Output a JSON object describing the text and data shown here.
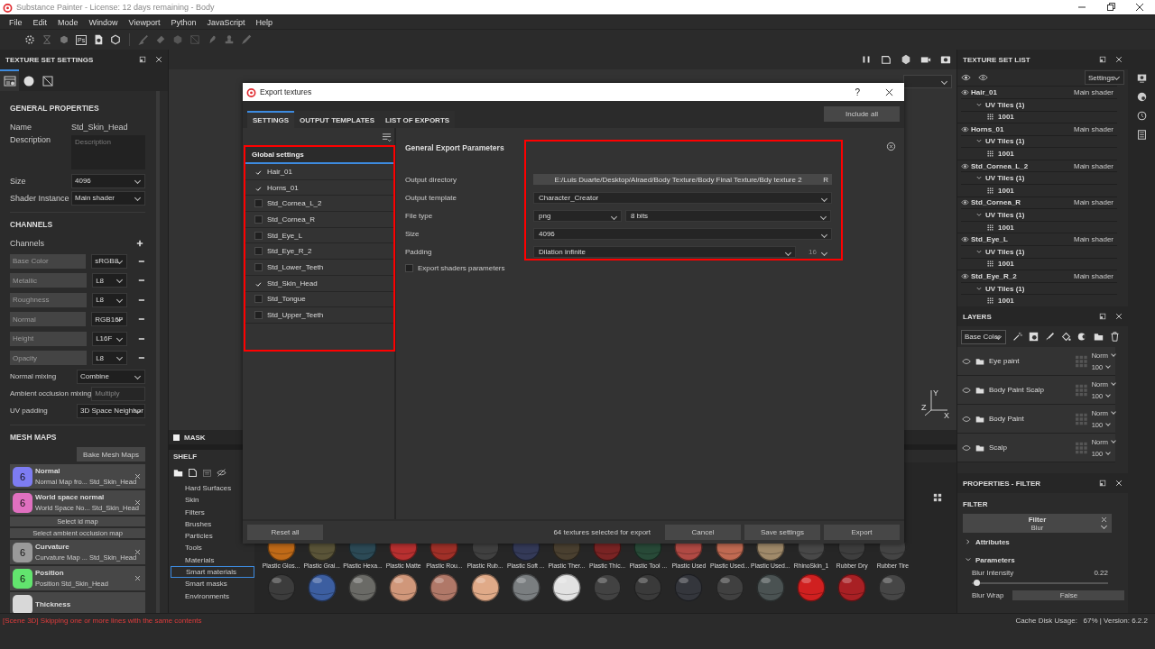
{
  "app_title": "Substance Painter - License: 12 days remaining - Body",
  "menu": [
    "File",
    "Edit",
    "Mode",
    "Window",
    "Viewport",
    "Python",
    "JavaScript",
    "Help"
  ],
  "toolbar": {
    "ps_label": "Ps"
  },
  "texture_set_settings": {
    "title": "TEXTURE SET SETTINGS",
    "tabs": [
      {
        "kind": "settings",
        "selected": true
      },
      {
        "kind": "material",
        "selected": false
      },
      {
        "kind": "uv",
        "selected": false
      }
    ],
    "general_title": "GENERAL PROPERTIES",
    "name_label": "Name",
    "name_value": "Std_Skin_Head",
    "description_label": "Description",
    "description_placeholder": "Description",
    "size_label": "Size",
    "size_value": "4096",
    "shader_label": "Shader Instance",
    "shader_value": "Main shader",
    "channels_title": "CHANNELS",
    "channels_label": "Channels",
    "channels": [
      {
        "name": "Base Color",
        "format": "sRGB8"
      },
      {
        "name": "Metallic",
        "format": "L8"
      },
      {
        "name": "Roughness",
        "format": "L8"
      },
      {
        "name": "Normal",
        "format": "RGB16F"
      },
      {
        "name": "Height",
        "format": "L16F"
      },
      {
        "name": "Opacity",
        "format": "L8"
      }
    ],
    "mixing": [
      {
        "label": "Normal mixing",
        "value": "Combine",
        "disabled": false
      },
      {
        "label": "Ambient occlusion mixing",
        "value": "Multiply",
        "disabled": true
      },
      {
        "label": "UV padding",
        "value": "3D Space Neighbor",
        "disabled": false
      }
    ],
    "mesh_maps_title": "MESH MAPS",
    "bake": "Bake Mesh Maps",
    "mesh_maps": [
      {
        "kind": "map",
        "name": "Normal",
        "source": "Normal Map fro... Std_Skin_Head",
        "badge": "6",
        "color": "#7d7cf2"
      },
      {
        "kind": "map",
        "name": "World space normal",
        "source": "World Space No... Std_Skin_Head",
        "badge": "6",
        "color": "#e070c0"
      },
      {
        "kind": "button",
        "name": "Select id map"
      },
      {
        "kind": "button",
        "name": "Select ambient occlusion map"
      },
      {
        "kind": "map",
        "name": "Curvature",
        "source": "Curvature Map ... Std_Skin_Head",
        "badge": "6",
        "color": "#9a9a9a"
      },
      {
        "kind": "map",
        "name": "Position",
        "source": "Position Std_Skin_Head",
        "badge": "6",
        "color": "#62e46e"
      },
      {
        "kind": "map",
        "name": "Thickness",
        "color": "#d8d8d8"
      }
    ]
  },
  "viewport": {
    "axes": [
      "Y",
      "Z",
      "X"
    ],
    "mask_label": "MASK",
    "mask_checked": true
  },
  "shelf": {
    "title": "SHELF",
    "categories": [
      {
        "label": "Hard Surfaces",
        "selected": false
      },
      {
        "label": "Skin",
        "selected": false
      },
      {
        "label": "Filters",
        "selected": false
      },
      {
        "label": "Brushes",
        "selected": false
      },
      {
        "label": "Particles",
        "selected": false
      },
      {
        "label": "Tools",
        "selected": false
      },
      {
        "label": "Materials",
        "selected": false
      },
      {
        "label": "Smart materials",
        "selected": true
      },
      {
        "label": "Smart masks",
        "selected": false
      },
      {
        "label": "Environments",
        "selected": false
      }
    ],
    "materials": [
      {
        "label": "Plastic Glos...",
        "color": "#c06a18"
      },
      {
        "label": "Plastic Grai...",
        "color": "#5a5438"
      },
      {
        "label": "Plastic Hexa...",
        "color": "#2c4a56"
      },
      {
        "label": "Plastic Matte",
        "color": "#b83030"
      },
      {
        "label": "Plastic Rou...",
        "color": "#a03028"
      },
      {
        "label": "Plastic Rub...",
        "color": "#404040"
      },
      {
        "label": "Plastic Soft ...",
        "color": "#343a58"
      },
      {
        "label": "Plastic Ther...",
        "color": "#4a4030"
      },
      {
        "label": "Plastic Thic...",
        "color": "#7a2424"
      },
      {
        "label": "Plastic Tool ...",
        "color": "#284a38"
      },
      {
        "label": "Plastic Used",
        "color": "#b04a44"
      },
      {
        "label": "Plastic Used...",
        "color": "#c06a52"
      },
      {
        "label": "Plastic Used...",
        "color": "#a08a6a"
      },
      {
        "label": "RhinoSkin_1",
        "color": "#484848"
      },
      {
        "label": "Rubber Dry",
        "color": "#3e3e3e"
      },
      {
        "label": "Rubber Tire",
        "color": "#444444"
      },
      {
        "color": "#3c3c3c"
      },
      {
        "color": "#3c5ea0"
      },
      {
        "color": "#6a6a66"
      },
      {
        "color": "#d0977a"
      },
      {
        "color": "#b07868"
      },
      {
        "color": "#e0aa88"
      },
      {
        "color": "#7a7e80"
      },
      {
        "color": "#e2e2e2"
      },
      {
        "color": "#424242"
      },
      {
        "color": "#3a3a3a"
      },
      {
        "color": "#34363c"
      },
      {
        "color": "#404040"
      },
      {
        "color": "#4a5252"
      },
      {
        "color": "#d02020"
      },
      {
        "color": "#a82024"
      },
      {
        "color": "#464646"
      }
    ]
  },
  "export_dialog": {
    "title": "Export textures",
    "help": "?",
    "tabs": [
      {
        "label": "SETTINGS",
        "selected": true
      },
      {
        "label": "OUTPUT TEMPLATES",
        "selected": false
      },
      {
        "label": "LIST OF EXPORTS",
        "selected": false
      }
    ],
    "include_all": "Include all",
    "list_header": "Global settings",
    "texture_sets": [
      {
        "name": "Hair_01",
        "checked": true
      },
      {
        "name": "Horns_01",
        "checked": true
      },
      {
        "name": "Std_Cornea_L_2",
        "checked": false
      },
      {
        "name": "Std_Cornea_R",
        "checked": false
      },
      {
        "name": "Std_Eye_L",
        "checked": false
      },
      {
        "name": "Std_Eye_R_2",
        "checked": false
      },
      {
        "name": "Std_Lower_Teeth",
        "checked": false
      },
      {
        "name": "Std_Skin_Head",
        "checked": true
      },
      {
        "name": "Std_Tongue",
        "checked": false
      },
      {
        "name": "Std_Upper_Teeth",
        "checked": false
      }
    ],
    "section_title": "General Export Parameters",
    "params": [
      {
        "kind": "path",
        "label": "Output directory",
        "value": "E:/Luis Duarte/Desktop/Alraed/Body Texture/Body Final Texture/Bdy texture 2",
        "suffix": "R"
      },
      {
        "kind": "select",
        "label": "Output template",
        "value": "Character_Creator"
      },
      {
        "kind": "pair",
        "label": "File type",
        "value": "png",
        "value2": "8 bits"
      },
      {
        "kind": "select",
        "label": "Size",
        "value": "4096"
      },
      {
        "kind": "padding",
        "label": "Padding",
        "value": "Dilation infinite",
        "value2": "16"
      }
    ],
    "export_shaders": {
      "label": "Export shaders parameters",
      "checked": false
    },
    "reset": "Reset all",
    "summary": "64 textures selected for export",
    "buttons": [
      "Cancel",
      "Save settings",
      "Export"
    ]
  },
  "texture_set_list": {
    "title": "TEXTURE SET LIST",
    "settings": "Settings",
    "sets": [
      {
        "name": "Hair_01",
        "shader": "Main shader",
        "uv": "UV Tiles (1)",
        "tile": "1001"
      },
      {
        "name": "Horns_01",
        "shader": "Main shader",
        "uv": "UV Tiles (1)",
        "tile": "1001"
      },
      {
        "name": "Std_Cornea_L_2",
        "shader": "Main shader",
        "uv": "UV Tiles (1)",
        "tile": "1001"
      },
      {
        "name": "Std_Cornea_R",
        "shader": "Main shader",
        "uv": "UV Tiles (1)",
        "tile": "1001"
      },
      {
        "name": "Std_Eye_L",
        "shader": "Main shader",
        "uv": "UV Tiles (1)",
        "tile": "1001"
      },
      {
        "name": "Std_Eye_R_2",
        "shader": "Main shader",
        "uv": "UV Tiles (1)",
        "tile": "1001"
      }
    ]
  },
  "layers": {
    "title": "LAYERS",
    "channel": "Base Color",
    "items": [
      {
        "name": "Eye paint",
        "blend": "Norm",
        "opacity": "100"
      },
      {
        "name": "Body Paint Scalp",
        "blend": "Norm",
        "opacity": "100"
      },
      {
        "name": "Body Paint",
        "blend": "Norm",
        "opacity": "100"
      },
      {
        "name": "Scalp",
        "blend": "Norm",
        "opacity": "100"
      }
    ]
  },
  "properties": {
    "title": "PROPERTIES - FILTER",
    "section": "FILTER",
    "filter_label": "Filter",
    "filter_value": "Blur",
    "groups": [
      {
        "label": "Attributes",
        "expanded": false
      },
      {
        "label": "Parameters",
        "expanded": true
      }
    ],
    "blur_intensity": {
      "label": "Blur Intensity",
      "value": "0.22",
      "level": 0.03
    },
    "blur_wrap": {
      "label": "Blur Wrap",
      "value": "False"
    }
  },
  "log": "[Scene 3D] Skipping one or more lines with the same contents",
  "status": "Cache Disk Usage:   67% | Version: 6.2.2"
}
